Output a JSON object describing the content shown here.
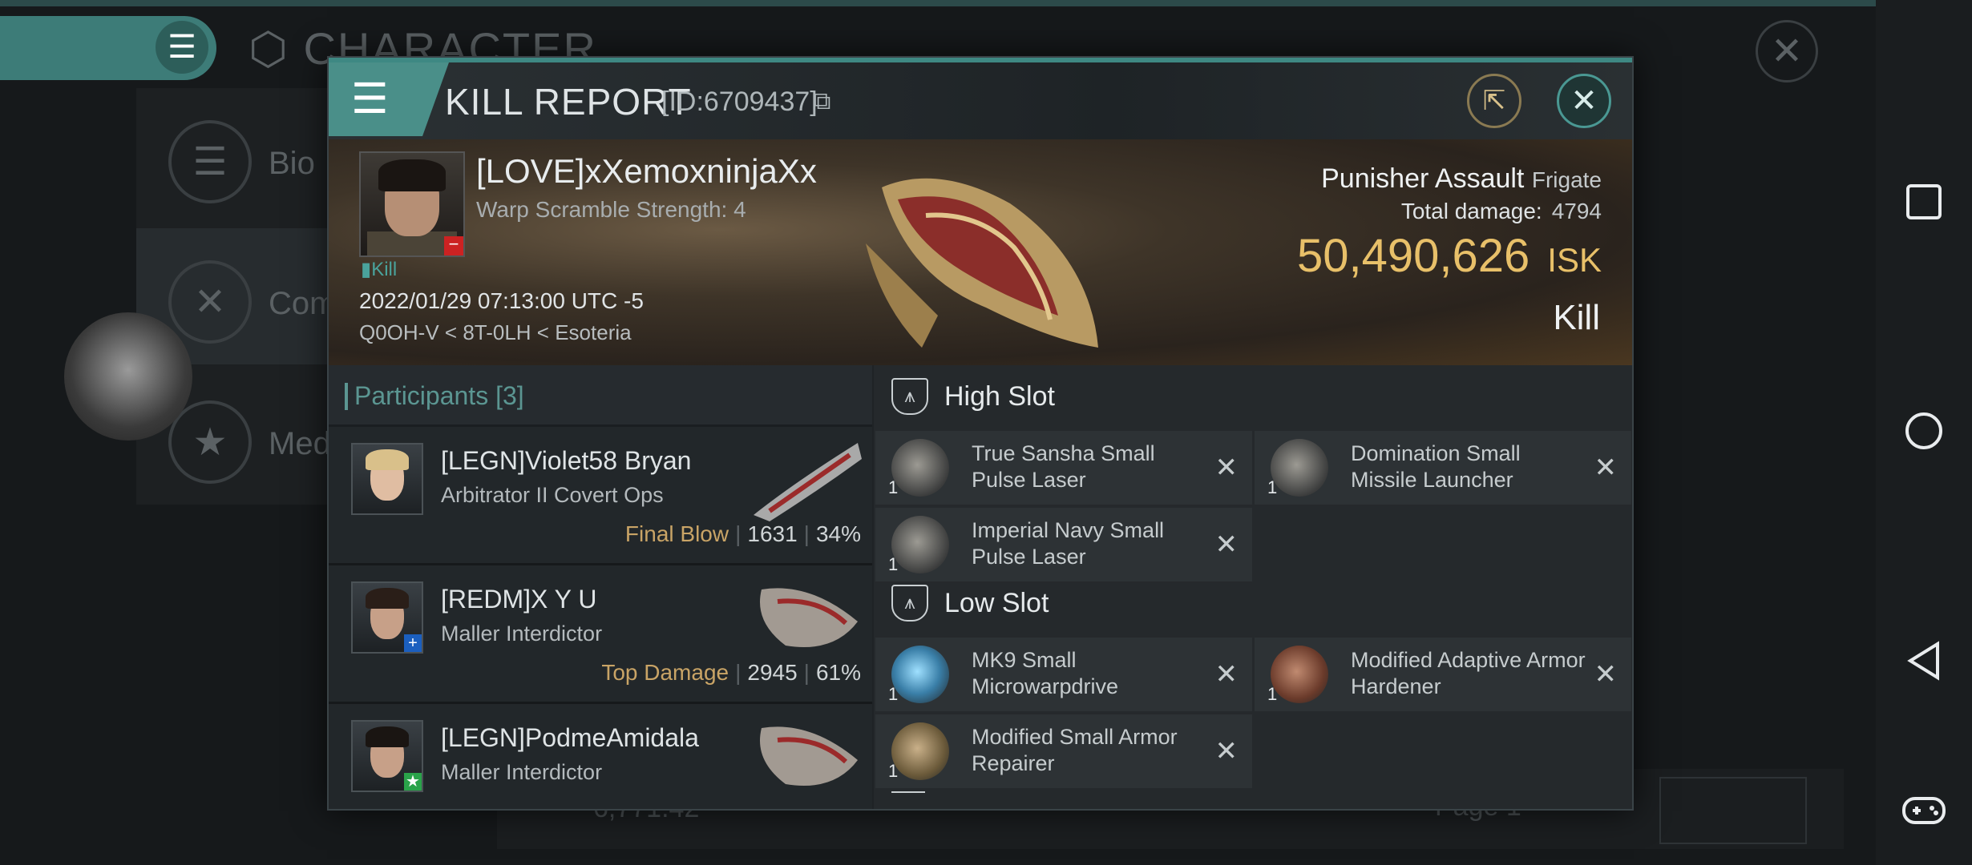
{
  "background": {
    "screen_title": "CHARACTER",
    "side_items": [
      {
        "label": "Bio",
        "icon": "list-icon"
      },
      {
        "label": "Com",
        "icon": "crossed-swords-icon"
      },
      {
        "label": "Med",
        "icon": "star-icon"
      }
    ],
    "bottom_value": "6,771.42",
    "page_label": "Page 1"
  },
  "dialog": {
    "title": "KILL REPORT",
    "id_label": "[ID:6709437]",
    "victim": {
      "name": "[LOVE]xXemoxninjaXx",
      "warp_scramble": "Warp Scramble Strength: 4",
      "tag": "Kill",
      "datetime": "2022/01/29 07:13:00 UTC -5",
      "location": "Q0OH-V < 8T-0LH < Esoteria"
    },
    "ship": {
      "name": "Punisher Assault",
      "class": "Frigate",
      "damage_label": "Total damage:",
      "damage_value": "4794",
      "isk_value": "50,490,626",
      "isk_unit": "ISK",
      "result": "Kill"
    },
    "participants": {
      "header": "Participants",
      "count": "[3]",
      "rows": [
        {
          "name": "[LEGN]Violet58 Bryan",
          "ship": "Arbitrator II Covert Ops",
          "stat_label": "Final Blow",
          "damage": "1631",
          "percent": "34%"
        },
        {
          "name": "[REDM]X Y U",
          "ship": "Maller Interdictor",
          "stat_label": "Top Damage",
          "damage": "2945",
          "percent": "61%"
        },
        {
          "name": "[LEGN]PodmeAmidala",
          "ship": "Maller Interdictor",
          "stat_label": "",
          "damage": "",
          "percent": ""
        }
      ]
    },
    "fitting": {
      "high_slot_label": "High Slot",
      "low_slot_label": "Low Slot",
      "high": [
        {
          "name": "True Sansha Small Pulse Laser",
          "qty": "1"
        },
        {
          "name": "Domination Small Missile Launcher",
          "qty": "1"
        },
        {
          "name": "Imperial Navy Small Pulse Laser",
          "qty": "1"
        }
      ],
      "low": [
        {
          "name": "MK9 Small Microwarpdrive",
          "qty": "1"
        },
        {
          "name": "Modified Adaptive Armor Hardener",
          "qty": "1"
        },
        {
          "name": "Modified Small Armor Repairer",
          "qty": "1"
        }
      ]
    }
  },
  "colors": {
    "accent": "#3e8883",
    "isk": "#e8c069",
    "final_blow": "#c9a466"
  }
}
